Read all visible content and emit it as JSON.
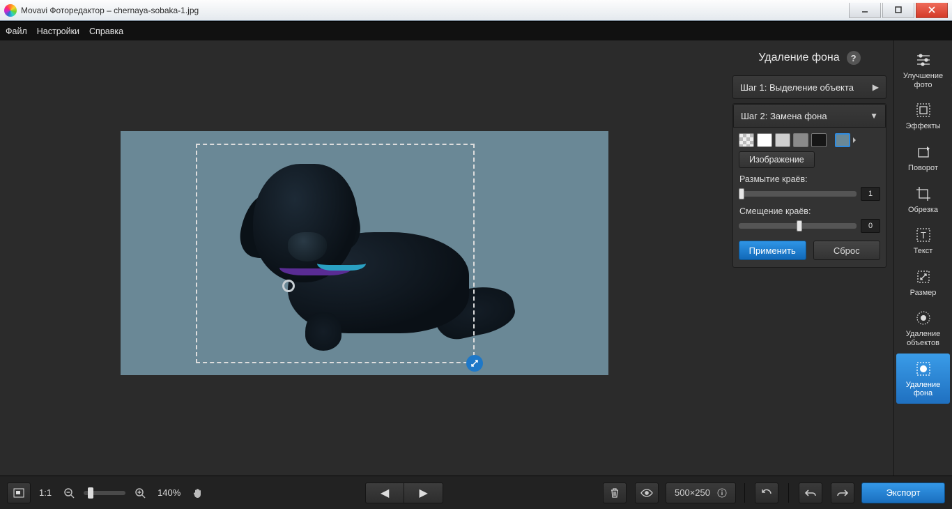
{
  "titlebar": {
    "app": "Movavi Фоторедактор",
    "file": "chernaya-sobaka-1.jpg"
  },
  "menu": {
    "file": "Файл",
    "settings": "Настройки",
    "help": "Справка"
  },
  "panel": {
    "title": "Удаление фона",
    "step1": "Шаг 1: Выделение объекта",
    "step2": "Шаг 2: Замена фона",
    "image_btn": "Изображение",
    "blur_label": "Размытие краёв:",
    "blur_value": "1",
    "offset_label": "Смещение краёв:",
    "offset_value": "0",
    "apply": "Применить",
    "reset": "Сброс"
  },
  "tools": {
    "enhance": "Улучшение фото",
    "effects": "Эффекты",
    "rotate": "Поворот",
    "crop": "Обрезка",
    "text": "Текст",
    "resize": "Размер",
    "object_removal": "Удаление объектов",
    "bg_removal": "Удаление фона"
  },
  "bottom": {
    "ratio": "1:1",
    "zoom": "140%",
    "dimensions": "500×250",
    "export": "Экспорт"
  }
}
